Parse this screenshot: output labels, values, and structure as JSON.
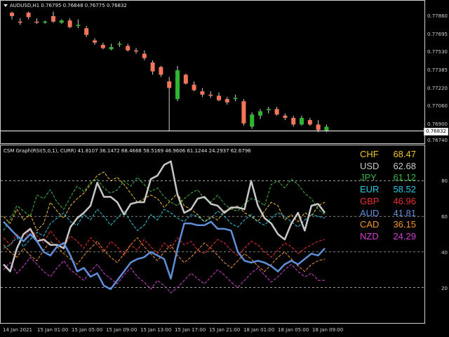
{
  "colors": {
    "background": "#000000",
    "bull": "#2fb52f",
    "bear": "#f4765a",
    "bid_line": "#ffffff",
    "grid_dashed": "#cfcfcf"
  },
  "price_panel": {
    "title": "AUDUSD,H1  0.76795 0.76848 0.76775 0.76832",
    "title_icon": "dropdown-arrow-icon",
    "price_ticks": [
      "0.77860",
      "0.77695",
      "0.77530",
      "0.77385",
      "0.77220",
      "0.77060",
      "0.76900",
      "0.76740"
    ],
    "bid_price": "0.76832"
  },
  "indicator_panel": {
    "title": "CSM Graph(RSI(5,0,1), CURR) 41.8107 36.1472 68.4668 58.5169 46.9606 61.1244 24.2937 62.6796",
    "level_ticks": [
      "80",
      "60",
      "40",
      "20"
    ],
    "legend": [
      {
        "currency": "CHF",
        "value": "68.47",
        "color": "#f2c230"
      },
      {
        "currency": "USD",
        "value": "62.68",
        "color": "#c8c8c8"
      },
      {
        "currency": "JPY",
        "value": "61.12",
        "color": "#3ab54a"
      },
      {
        "currency": "EUR",
        "value": "58.52",
        "color": "#2ec8e0"
      },
      {
        "currency": "GBP",
        "value": "46.96",
        "color": "#e83030"
      },
      {
        "currency": "AUD",
        "value": "41.81",
        "color": "#5f8fd8"
      },
      {
        "currency": "CAD",
        "value": "36.15",
        "color": "#f0962e"
      },
      {
        "currency": "NZD",
        "value": "24.29",
        "color": "#d040d0"
      }
    ]
  },
  "time_axis": [
    "14 Jan 2021",
    "15 Jan 01:00",
    "15 Jan 05:00",
    "15 Jan 09:00",
    "15 Jan 13:00",
    "15 Jan 17:00",
    "15 Jan 21:00",
    "18 Jan 01:00",
    "18 Jan 05:00",
    "18 Jan 09:00"
  ],
  "chart_data": [
    {
      "type": "candlestick",
      "title": "AUDUSD,H1",
      "ylim": [
        0.7674,
        0.7792
      ],
      "candles": [
        {
          "o": 0.779,
          "h": 0.7791,
          "l": 0.7784,
          "c": 0.7787
        },
        {
          "o": 0.7782,
          "h": 0.7785,
          "l": 0.7779,
          "c": 0.7781
        },
        {
          "o": 0.779,
          "h": 0.7791,
          "l": 0.7784,
          "c": 0.7786
        },
        {
          "o": 0.7782,
          "h": 0.7785,
          "l": 0.778,
          "c": 0.7781
        },
        {
          "o": 0.7781,
          "h": 0.7783,
          "l": 0.778,
          "c": 0.7782
        },
        {
          "o": 0.7787,
          "h": 0.7791,
          "l": 0.7781,
          "c": 0.7782
        },
        {
          "o": 0.7781,
          "h": 0.7784,
          "l": 0.778,
          "c": 0.7783
        },
        {
          "o": 0.7783,
          "h": 0.7785,
          "l": 0.7776,
          "c": 0.7777
        },
        {
          "o": 0.7778,
          "h": 0.7784,
          "l": 0.7776,
          "c": 0.7779
        },
        {
          "o": 0.7776,
          "h": 0.7778,
          "l": 0.7768,
          "c": 0.777
        },
        {
          "o": 0.7765,
          "h": 0.7767,
          "l": 0.7761,
          "c": 0.7763
        },
        {
          "o": 0.7761,
          "h": 0.7763,
          "l": 0.7757,
          "c": 0.7758
        },
        {
          "o": 0.7757,
          "h": 0.7762,
          "l": 0.7756,
          "c": 0.7759
        },
        {
          "o": 0.7761,
          "h": 0.7764,
          "l": 0.7759,
          "c": 0.7762
        },
        {
          "o": 0.776,
          "h": 0.7762,
          "l": 0.7755,
          "c": 0.7756
        },
        {
          "o": 0.7756,
          "h": 0.7758,
          "l": 0.7753,
          "c": 0.7755
        },
        {
          "o": 0.7753,
          "h": 0.7756,
          "l": 0.7747,
          "c": 0.7749
        },
        {
          "o": 0.7745,
          "h": 0.7747,
          "l": 0.7734,
          "c": 0.7737
        },
        {
          "o": 0.7741,
          "h": 0.7742,
          "l": 0.7732,
          "c": 0.7734
        },
        {
          "o": 0.7728,
          "h": 0.7732,
          "l": 0.7683,
          "c": 0.7722
        },
        {
          "o": 0.7712,
          "h": 0.7742,
          "l": 0.771,
          "c": 0.7738
        },
        {
          "o": 0.7734,
          "h": 0.7735,
          "l": 0.7725,
          "c": 0.7726
        },
        {
          "o": 0.7725,
          "h": 0.7728,
          "l": 0.7719,
          "c": 0.772
        },
        {
          "o": 0.7719,
          "h": 0.7722,
          "l": 0.7714,
          "c": 0.7716
        },
        {
          "o": 0.7716,
          "h": 0.7719,
          "l": 0.7713,
          "c": 0.7715
        },
        {
          "o": 0.7715,
          "h": 0.7718,
          "l": 0.771,
          "c": 0.7711
        },
        {
          "o": 0.7712,
          "h": 0.7714,
          "l": 0.7707,
          "c": 0.7709
        },
        {
          "o": 0.7712,
          "h": 0.7716,
          "l": 0.771,
          "c": 0.7713
        },
        {
          "o": 0.771,
          "h": 0.7712,
          "l": 0.7688,
          "c": 0.769
        },
        {
          "o": 0.7687,
          "h": 0.77,
          "l": 0.7685,
          "c": 0.7698
        },
        {
          "o": 0.7697,
          "h": 0.7703,
          "l": 0.7694,
          "c": 0.7701
        },
        {
          "o": 0.7702,
          "h": 0.7705,
          "l": 0.7699,
          "c": 0.7703
        },
        {
          "o": 0.7703,
          "h": 0.7705,
          "l": 0.7697,
          "c": 0.7698
        },
        {
          "o": 0.7697,
          "h": 0.7699,
          "l": 0.7693,
          "c": 0.7695
        },
        {
          "o": 0.7695,
          "h": 0.7697,
          "l": 0.7687,
          "c": 0.7689
        },
        {
          "o": 0.7689,
          "h": 0.7697,
          "l": 0.7688,
          "c": 0.7695
        },
        {
          "o": 0.7693,
          "h": 0.7695,
          "l": 0.7688,
          "c": 0.7689
        },
        {
          "o": 0.7689,
          "h": 0.7693,
          "l": 0.7682,
          "c": 0.7684
        },
        {
          "o": 0.7683,
          "h": 0.7689,
          "l": 0.7682,
          "c": 0.7687
        }
      ]
    },
    {
      "type": "line",
      "title": "CSM Graph(RSI(5,0,1), CURR)",
      "ylim": [
        0,
        100
      ],
      "levels": [
        80,
        60,
        40,
        20
      ],
      "series": [
        {
          "name": "USD",
          "color": "#c8c8c8",
          "width": 2.5,
          "dash": false,
          "values": [
            33,
            29,
            42,
            50,
            53,
            46,
            47,
            44,
            44,
            42,
            54,
            59,
            62,
            66,
            79,
            71,
            71,
            68,
            61,
            67,
            68,
            68,
            81,
            83,
            89,
            91,
            72,
            62,
            64,
            70,
            71,
            67,
            66,
            62,
            65,
            65,
            64,
            80,
            66,
            59,
            56,
            50,
            47,
            56,
            62,
            52,
            66,
            67,
            62
          ]
        },
        {
          "name": "AUD",
          "color": "#5f8fd8",
          "width": 2.5,
          "dash": false,
          "values": [
            57,
            53,
            49,
            46,
            50,
            46,
            40,
            38,
            43,
            45,
            38,
            29,
            31,
            26,
            28,
            21,
            19,
            24,
            29,
            34,
            36,
            37,
            40,
            38,
            36,
            25,
            42,
            56,
            56,
            55,
            55,
            57,
            53,
            53,
            52,
            40,
            35,
            34,
            35,
            34,
            32,
            29,
            33,
            35,
            33,
            36,
            39,
            38,
            42
          ]
        },
        {
          "name": "CHF",
          "color": "#f2c230",
          "width": 1,
          "dash": true,
          "values": [
            60,
            56,
            64,
            58,
            61,
            52,
            56,
            68,
            63,
            59,
            66,
            70,
            73,
            78,
            83,
            85,
            80,
            82,
            78,
            73,
            68,
            70,
            72,
            70,
            65,
            69,
            73,
            66,
            64,
            61,
            57,
            60,
            58,
            63,
            64,
            66,
            62,
            60,
            57,
            63,
            68,
            66,
            58,
            61,
            57,
            62,
            60,
            66,
            68
          ]
        },
        {
          "name": "JPY",
          "color": "#3ab54a",
          "width": 1,
          "dash": true,
          "values": [
            52,
            58,
            66,
            63,
            60,
            72,
            70,
            75,
            68,
            64,
            71,
            77,
            74,
            79,
            81,
            76,
            73,
            75,
            80,
            77,
            82,
            78,
            74,
            76,
            71,
            68,
            66,
            70,
            73,
            75,
            70,
            68,
            72,
            67,
            64,
            63,
            67,
            70,
            69,
            66,
            78,
            80,
            76,
            81,
            78,
            73,
            70,
            64,
            61
          ]
        },
        {
          "name": "EUR",
          "color": "#2ec8e0",
          "width": 1,
          "dash": true,
          "values": [
            42,
            44,
            48,
            43,
            47,
            51,
            49,
            56,
            59,
            62,
            57,
            55,
            61,
            58,
            64,
            60,
            55,
            59,
            63,
            57,
            52,
            55,
            61,
            58,
            64,
            62,
            59,
            57,
            61,
            60,
            57,
            59,
            63,
            60,
            56,
            54,
            58,
            61,
            57,
            55,
            59,
            62,
            60,
            57,
            54,
            58,
            61,
            60,
            59
          ]
        },
        {
          "name": "GBP",
          "color": "#e83030",
          "width": 1,
          "dash": true,
          "values": [
            48,
            44,
            50,
            46,
            53,
            49,
            45,
            52,
            47,
            43,
            49,
            46,
            42,
            48,
            44,
            40,
            46,
            43,
            38,
            44,
            41,
            47,
            43,
            39,
            45,
            42,
            48,
            44,
            46,
            41,
            39,
            43,
            47,
            45,
            41,
            38,
            42,
            46,
            44,
            40,
            37,
            41,
            45,
            43,
            39,
            42,
            44,
            46,
            47
          ]
        },
        {
          "name": "CAD",
          "color": "#f0962e",
          "width": 1,
          "dash": true,
          "values": [
            44,
            40,
            37,
            42,
            38,
            35,
            41,
            46,
            43,
            39,
            36,
            33,
            38,
            42,
            46,
            41,
            37,
            34,
            39,
            44,
            48,
            43,
            39,
            35,
            40,
            44,
            38,
            34,
            37,
            41,
            45,
            42,
            38,
            34,
            31,
            35,
            39,
            36,
            32,
            29,
            33,
            37,
            40,
            36,
            32,
            29,
            33,
            35,
            36
          ]
        },
        {
          "name": "NZD",
          "color": "#d040d0",
          "width": 1,
          "dash": true,
          "values": [
            30,
            34,
            28,
            32,
            37,
            33,
            29,
            26,
            31,
            35,
            30,
            27,
            24,
            29,
            33,
            28,
            25,
            22,
            27,
            31,
            26,
            23,
            19,
            24,
            21,
            17,
            20,
            24,
            28,
            25,
            22,
            26,
            30,
            27,
            23,
            20,
            24,
            28,
            31,
            27,
            23,
            26,
            30,
            33,
            29,
            26,
            28,
            24,
            24
          ]
        }
      ]
    }
  ]
}
